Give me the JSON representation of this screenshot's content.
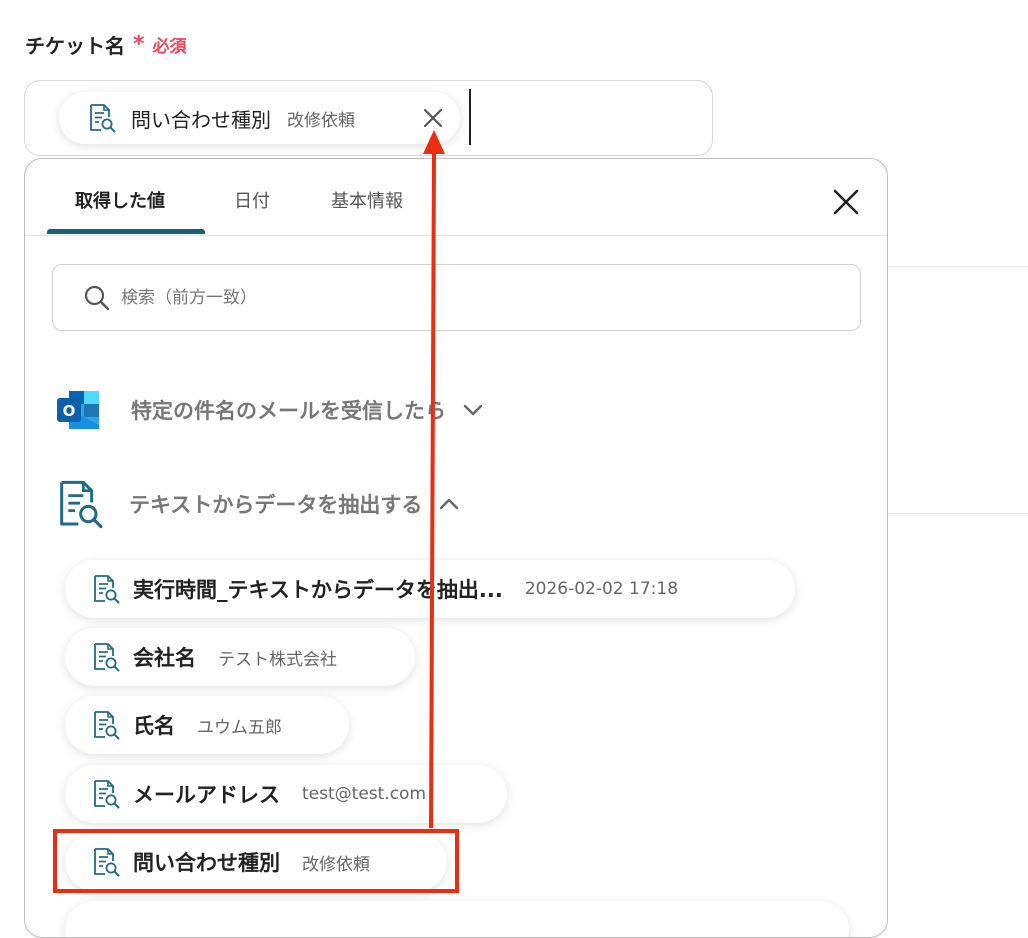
{
  "field": {
    "label": "チケット名",
    "required_star": "*",
    "required_text": "必須"
  },
  "ticket_input": {
    "chip": {
      "name": "問い合わせ種別",
      "value": "改修依頼"
    }
  },
  "panel": {
    "tabs": [
      {
        "label": "取得した値",
        "active": true
      },
      {
        "label": "日付",
        "active": false
      },
      {
        "label": "基本情報",
        "active": false
      }
    ],
    "search_placeholder": "検索（前方一致）",
    "sections": [
      {
        "title": "特定の件名のメールを受信したら",
        "icon": "outlook-icon",
        "expanded": false
      },
      {
        "title": "テキストからデータを抽出する",
        "icon": "document-search-icon",
        "expanded": true
      }
    ],
    "items": [
      {
        "name": "実行時間_テキストからデータを抽出...",
        "value": "2026-02-02 17:18"
      },
      {
        "name": "会社名",
        "value": "テスト株式会社"
      },
      {
        "name": "氏名",
        "value": "ユウム五郎"
      },
      {
        "name": "メールアドレス",
        "value": "test@test.com"
      },
      {
        "name": "問い合わせ種別",
        "value": "改修依頼"
      }
    ]
  },
  "colors": {
    "accent": "#17627a",
    "required": "#e8485a",
    "annotation": "#ea2e14"
  }
}
